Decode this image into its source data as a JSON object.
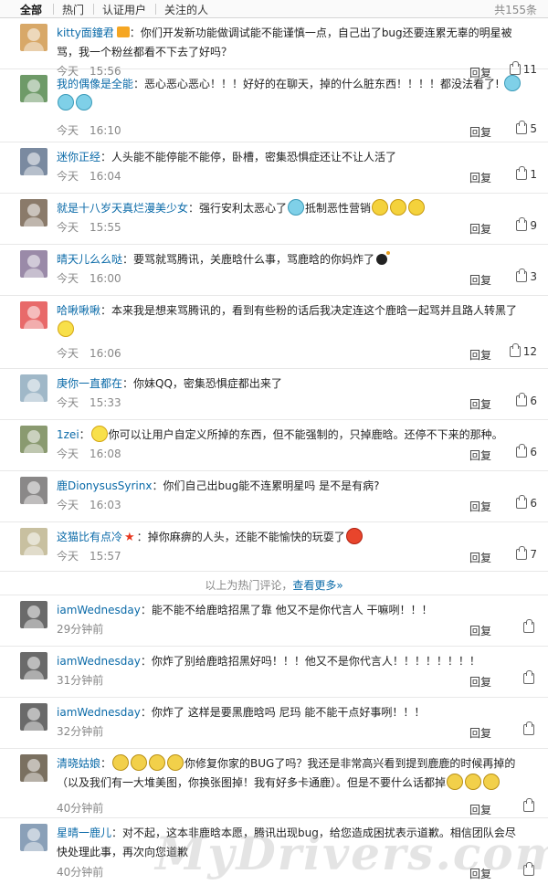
{
  "tabs": {
    "all": "全部",
    "hot": "热门",
    "verified": "认证用户",
    "following": "关注的人",
    "total": "共155条"
  },
  "hot_comments": [
    {
      "name": "kitty面鐘君",
      "text": "你们开发新功能做调试能不能谨慎一点，自己出了bug还要连累无辜的明星被骂，我一个粉丝都看不下去了好吗？",
      "time": "今天　15:56",
      "reply": "回复",
      "likes": "11",
      "avatar_color": "#d8a868"
    },
    {
      "name": "我的偶像是全能",
      "text": "恶心恶心恶心！！！好好的在聊天，掉的什么脏东西！！！！都没法看了!",
      "time": "今天　16:10",
      "reply": "回复",
      "likes": "5",
      "avatar_color": "#6e9a68"
    },
    {
      "name": "迷你正经",
      "text": "人头能不能停能不能停，卧槽，密集恐惧症还让不让人活了",
      "time": "今天　16:04",
      "reply": "回复",
      "likes": "1",
      "avatar_color": "#7a8aa0"
    },
    {
      "name": "就是十八岁天真烂漫美少女",
      "text": "强行安利太恶心了",
      "text2": "抵制恶性营销",
      "time": "今天　15:55",
      "reply": "回复",
      "likes": "9",
      "avatar_color": "#8a7a6a"
    },
    {
      "name": "晴天儿么么哒",
      "text": "要骂就骂腾讯，关鹿晗什么事，骂鹿晗的你妈炸了",
      "time": "今天　16:00",
      "reply": "回复",
      "likes": "3",
      "avatar_color": "#9a8aa8"
    },
    {
      "name": "哈啾啾啾",
      "text": "本来我是想来骂腾讯的，看到有些粉的话后我决定连这个鹿晗一起骂并且路人转黑了",
      "time": "今天　16:06",
      "reply": "回复",
      "likes": "12",
      "avatar_color": "#e86a6a"
    },
    {
      "name": "庚你一直都在",
      "text": "你妹QQ，密集恐惧症都出来了",
      "time": "今天　15:33",
      "reply": "回复",
      "likes": "6",
      "avatar_color": "#a0b8c8"
    },
    {
      "name": "1zei",
      "text": "你可以让用户自定义所掉的东西，但不能强制的，只掉鹿晗。还停不下来的那种。",
      "time": "今天　16:08",
      "reply": "回复",
      "likes": "6",
      "avatar_color": "#8a9a70"
    },
    {
      "name": "鹿DionysusSyrinx",
      "text": "你们自己出bug能不连累明星吗 是不是有病?",
      "time": "今天　16:03",
      "reply": "回复",
      "likes": "6",
      "avatar_color": "#8a8888"
    },
    {
      "name": "这猫比有点冷",
      "text": "掉你麻痹的人头，还能不能愉快的玩耍了",
      "time": "今天　15:57",
      "reply": "回复",
      "likes": "7",
      "avatar_color": "#c8c0a0"
    }
  ],
  "divider": {
    "text": "以上为热门评论，",
    "link": "查看更多»"
  },
  "latest_comments": [
    {
      "name": "iamWednesday",
      "text": "能不能不给鹿晗招黑了靠  他又不是你代言人  干嘛咧！！！",
      "time": "29分钟前",
      "reply": "回复",
      "avatar_color": "#6a6a6a"
    },
    {
      "name": "iamWednesday",
      "text": "你炸了别给鹿晗招黑好吗！！！他又不是你代言人！！！！！！！！",
      "time": "31分钟前",
      "reply": "回复",
      "avatar_color": "#6a6a6a"
    },
    {
      "name": "iamWednesday",
      "text": "你炸了  这样是要黑鹿晗吗  尼玛  能不能干点好事咧！！！",
      "time": "32分钟前",
      "reply": "回复",
      "avatar_color": "#6a6a6a"
    },
    {
      "name": "清晓姑娘",
      "text": "你修复你家的BUG了吗？我还是非常高兴看到提到鹿鹿的时候再掉的（以及我们有一大堆美图，你换张图掉！我有好多卡通鹿）。但是不要什么话都掉",
      "time": "40分钟前",
      "reply": "回复",
      "avatar_color": "#7a7060"
    },
    {
      "name": "星晴一鹿儿",
      "text": "对不起，这本非鹿晗本愿，腾讯出现bug，给您造成困扰表示道歉。相信团队会尽快处理此事，再次向您道歉",
      "time": "40分钟前",
      "reply": "回复",
      "avatar_color": "#8aa0b8"
    }
  ],
  "watermark": "MyDrivers.com"
}
